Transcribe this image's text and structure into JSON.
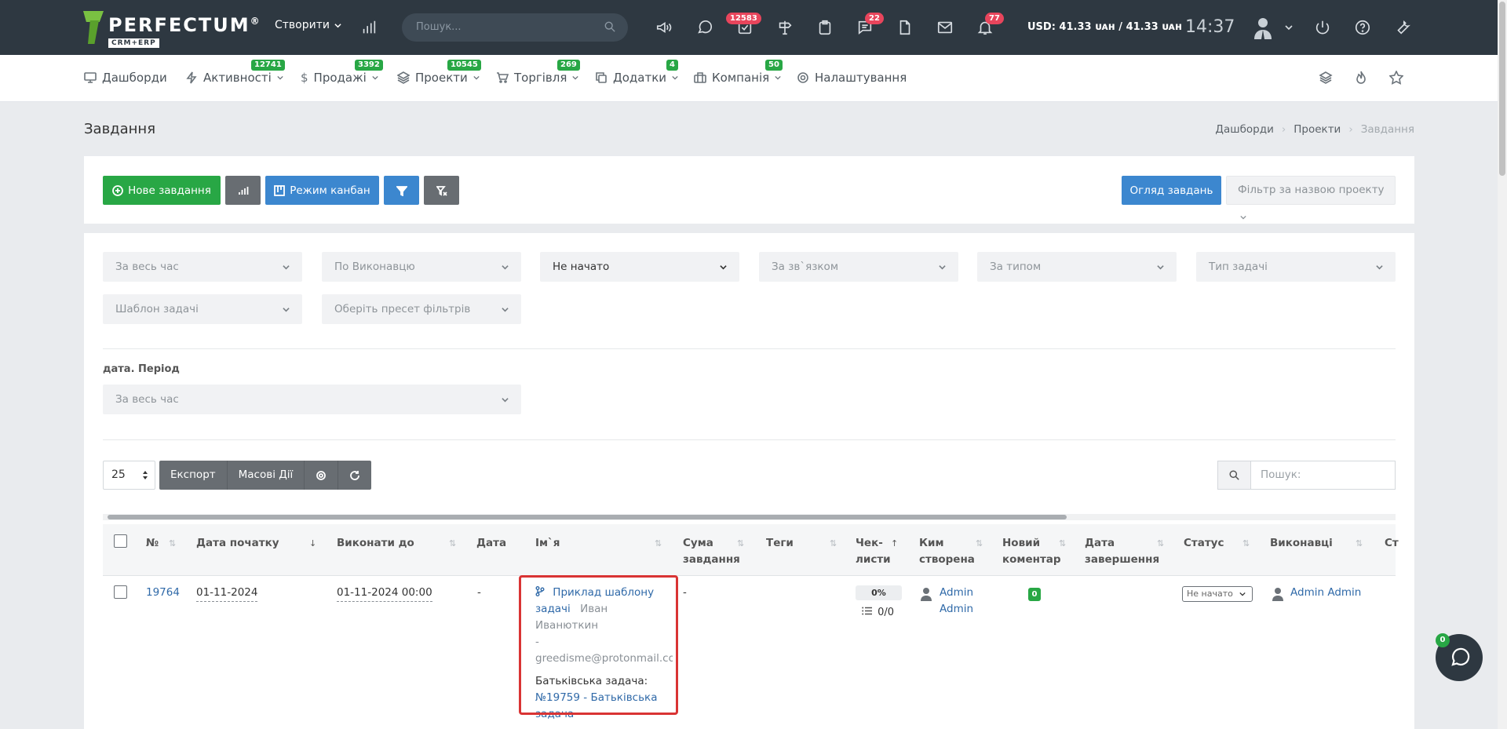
{
  "topbar": {
    "logo_name": "PERFECTUM",
    "logo_reg": "®",
    "logo_sub": "CRM+ERP",
    "create_label": "Створити",
    "search_placeholder": "Пошук...",
    "badges": {
      "tasks": "12583",
      "messages": "22",
      "notifications": "77"
    },
    "currency": "USD: 41.33 ᴜᴀн / 41.33 ᴜᴀн",
    "time": "14:37"
  },
  "nav": {
    "items": [
      {
        "label": "Дашборди",
        "badge": ""
      },
      {
        "label": "Активності",
        "badge": "12741"
      },
      {
        "label": "Продажі",
        "badge": "3392"
      },
      {
        "label": "Проекти",
        "badge": "10545"
      },
      {
        "label": "Торгівля",
        "badge": "269"
      },
      {
        "label": "Додатки",
        "badge": "4"
      },
      {
        "label": "Компанія",
        "badge": "50"
      },
      {
        "label": "Налаштування",
        "badge": ""
      }
    ]
  },
  "page": {
    "title": "Завдання",
    "breadcrumb": [
      "Дашборди",
      "Проекти",
      "Завдання"
    ]
  },
  "toolbar": {
    "new_task": "Нове завдання",
    "kanban": "Режим канбан",
    "overview": "Огляд завдань",
    "project_filter": "Фільтр за назвою проекту"
  },
  "filters": {
    "period": "За весь час",
    "assignee": "По Виконавцю",
    "status": "Не начато",
    "relation": "За зв`язком",
    "by_type": "За типом",
    "task_type": "Тип задачі",
    "template": "Шаблон задачі",
    "preset": "Оберіть пресет фільтрів",
    "date_label": "дата. Період",
    "date_period": "За весь час"
  },
  "table_controls": {
    "page_size": "25",
    "export": "Експорт",
    "bulk": "Масові Дії",
    "search_placeholder": "Пошук:"
  },
  "columns": [
    "№",
    "Дата початку",
    "Виконати до",
    "Дата",
    "Ім`я",
    "Сума завдання",
    "Теги",
    "Чек-листи",
    "Ким створена",
    "Новий коментар",
    "Дата завершення",
    "Статус",
    "Виконавці",
    "Ст"
  ],
  "column_lines": {
    "sum": [
      "Сума",
      "завдання"
    ],
    "check": [
      "Чек-",
      "листи"
    ],
    "creator": [
      "Ким",
      "створена"
    ],
    "comment": [
      "Новий",
      "коментар"
    ],
    "finish": [
      "Дата",
      "завершення"
    ]
  },
  "row": {
    "id": "19764",
    "start": "01-11-2024",
    "due": "01-11-2024 00:00",
    "date": "-",
    "name_l1": "Приклад шаблону",
    "name_l2": "задачі",
    "client": "Иван Иванюткин",
    "dash": "-",
    "email": "greedisme@protonmail.co",
    "parent_label": "Батьківська задача:",
    "parent_l1": "№19759 - Батьківська",
    "parent_l2": "задача",
    "sum": "-",
    "check_pct": "0%",
    "check_count": "0/0",
    "creator_l1": "Admin",
    "creator_l2": "Admin",
    "new_comment": "0",
    "status": "Не начато",
    "assignee": "Admin Admin"
  },
  "chat": {
    "badge": "0"
  }
}
